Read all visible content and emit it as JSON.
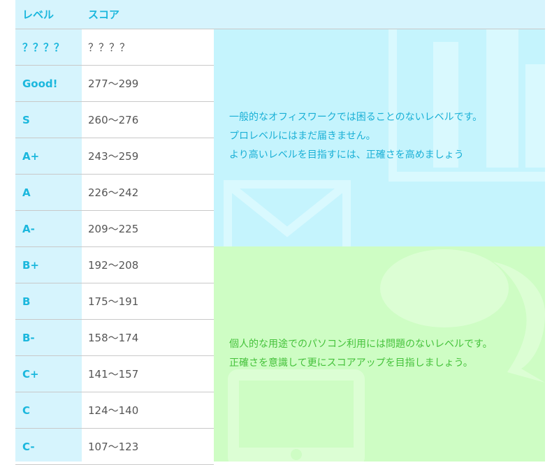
{
  "table": {
    "headers": {
      "level": "レベル",
      "score": "スコア"
    },
    "rows": [
      {
        "level": "？？？？",
        "score": "？？？？"
      },
      {
        "level": "Good!",
        "score": "277〜299"
      },
      {
        "level": "S",
        "score": "260〜276"
      },
      {
        "level": "A+",
        "score": "243〜259"
      },
      {
        "level": "A",
        "score": "226〜242"
      },
      {
        "level": "A-",
        "score": "209〜225"
      },
      {
        "level": "B+",
        "score": "192〜208"
      },
      {
        "level": "B",
        "score": "175〜191"
      },
      {
        "level": "B-",
        "score": "158〜174"
      },
      {
        "level": "C+",
        "score": "141〜157"
      },
      {
        "level": "C",
        "score": "124〜140"
      },
      {
        "level": "C-",
        "score": "107〜123"
      }
    ]
  },
  "panels": {
    "office": {
      "lines": [
        "一般的なオフィスワークでは困ることのないレベルです。",
        "プロレベルにはまだ届きません。",
        "より高いレベルを目指すには、正確さを高めましょう"
      ],
      "icons": [
        "bar-chart-icon",
        "envelope-icon"
      ]
    },
    "personal": {
      "lines": [
        "個人的な用途でのパソコン利用には問題のないレベルです。",
        "正確さを意識して更にスコアアップを目指しましょう。"
      ],
      "icons": [
        "speech-bubble-icon",
        "tablet-icon"
      ]
    }
  },
  "colors": {
    "accent": "#1bb7dd",
    "level_bg": "#d6f4fd",
    "office_bg": "#c5f4fd",
    "personal_bg": "#cefdc4",
    "personal_text": "#45c23b"
  }
}
